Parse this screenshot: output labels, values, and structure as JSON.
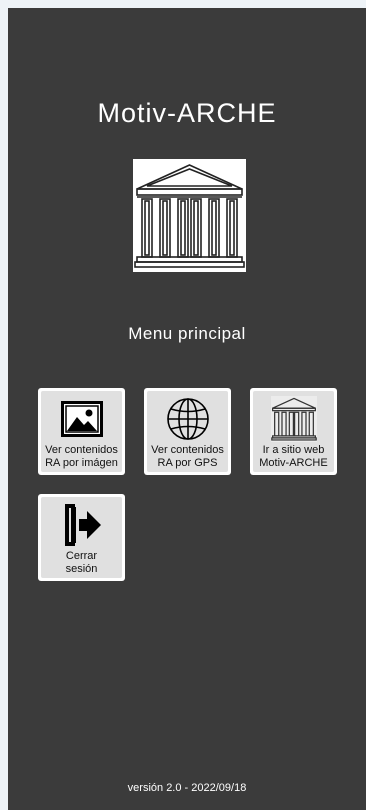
{
  "app": {
    "title": "Motiv-ARCHE"
  },
  "menu": {
    "title": "Menu principal",
    "tiles": [
      {
        "label": "Ver contenidos\nRA por imágen",
        "icon": "image-icon"
      },
      {
        "label": "Ver contenidos\nRA por GPS",
        "icon": "globe-icon"
      },
      {
        "label": "Ir a sitio web\nMotiv-ARCHE",
        "icon": "temple-icon"
      },
      {
        "label": "Cerrar\nsesión",
        "icon": "logout-icon"
      }
    ]
  },
  "footer": {
    "version": "versión 2.0 - 2022/09/18"
  },
  "colors": {
    "background": "#3b3b3b",
    "tile": "#e0e0e0",
    "text": "#ffffff"
  }
}
